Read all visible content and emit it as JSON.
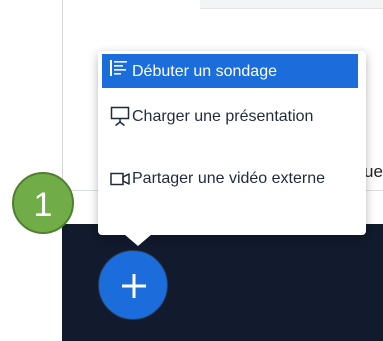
{
  "menu": {
    "items": [
      {
        "label": "Débuter un sondage",
        "icon": "poll-icon",
        "selected": true
      },
      {
        "label": "Charger une présentation",
        "icon": "presentation-icon",
        "selected": false
      },
      {
        "label": "Partager une vidéo externe",
        "icon": "video-icon",
        "selected": false
      }
    ]
  },
  "callout": {
    "number": "1"
  },
  "background": {
    "partial_text": "ue"
  },
  "actions": {
    "add_icon": "plus-icon"
  },
  "colors": {
    "accent": "#1b6ddb",
    "bottom_bar": "#121a2e",
    "callout_fill": "#70ad47",
    "callout_border": "#507e32"
  }
}
